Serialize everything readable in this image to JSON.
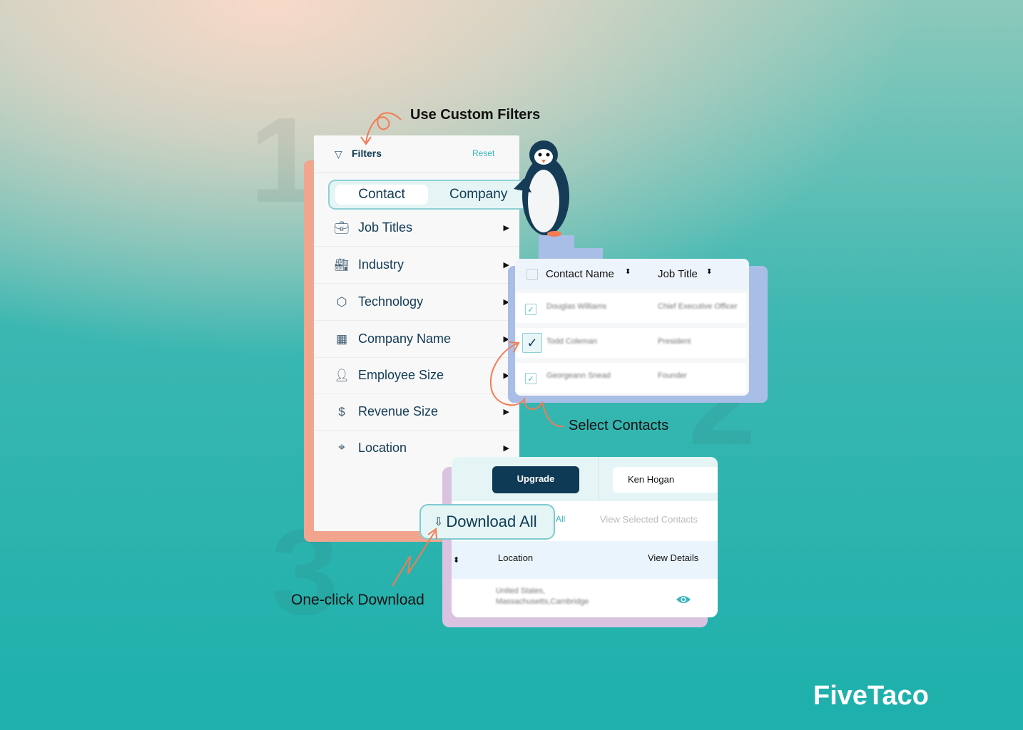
{
  "callouts": {
    "filters": "Use Custom Filters",
    "contacts": "Select Contacts",
    "download": "One-click Download"
  },
  "step_numbers": [
    "1",
    "2",
    "3"
  ],
  "filters": {
    "title": "Filters",
    "reset": "Reset",
    "tabs": [
      "Contact",
      "Company"
    ],
    "active_tab": "Contact",
    "items": [
      {
        "label": "Job Titles",
        "icon": "briefcase-icon"
      },
      {
        "label": "Industry",
        "icon": "factory-icon"
      },
      {
        "label": "Technology",
        "icon": "cube-icon"
      },
      {
        "label": "Company Name",
        "icon": "building-icon"
      },
      {
        "label": "Employee Size",
        "icon": "person-icon"
      },
      {
        "label": "Revenue Size",
        "icon": "dollar-icon"
      },
      {
        "label": "Location",
        "icon": "pin-icon"
      }
    ]
  },
  "contacts": {
    "columns": [
      "Contact Name",
      "Job Title"
    ],
    "rows": [
      {
        "name": "Douglas Williams",
        "title": "Chief Executive Officer",
        "checked": true
      },
      {
        "name": "Todd Coleman",
        "title": "President",
        "checked": true
      },
      {
        "name": "Georgeann Snead",
        "title": "Founder",
        "checked": true
      }
    ]
  },
  "download": {
    "upgrade": "Upgrade",
    "user": "Ken Hogan",
    "download_all": "Download All",
    "all": "All",
    "view_selected": "View Selected Contacts",
    "columns": [
      "Location",
      "View Details"
    ],
    "rows": [
      {
        "location_line1": "United States,",
        "location_line2": "Massachusetts,Cambridge"
      }
    ]
  },
  "brand": "FiveTaco",
  "colors": {
    "accent": "#3bb5bd",
    "dark": "#0e3a55",
    "salmon": "#f2a58e",
    "orange": "#f47b52"
  }
}
